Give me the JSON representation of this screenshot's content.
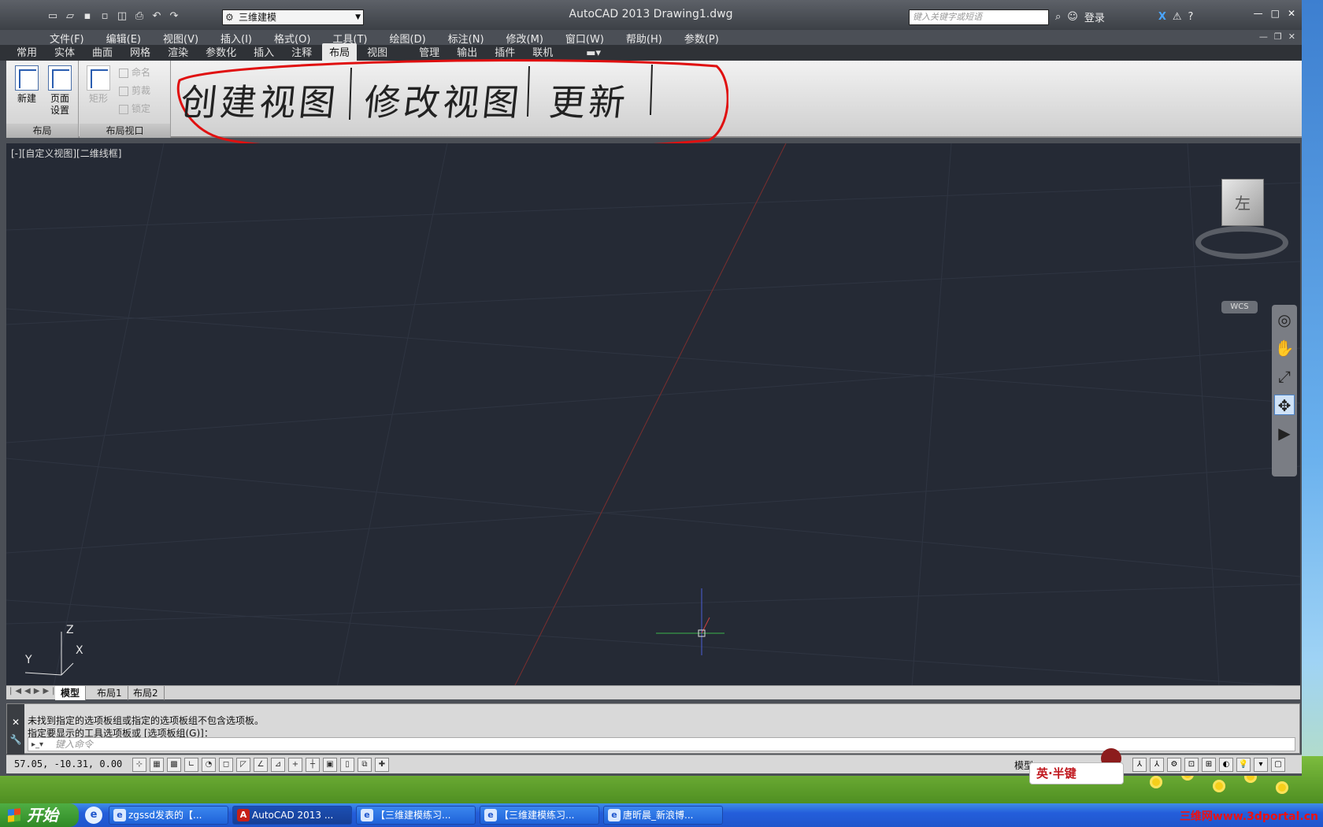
{
  "app": {
    "title": "AutoCAD 2013    Drawing1.dwg",
    "logo": "A",
    "workspace": "三维建模",
    "search_placeholder": "键入关键字或短语",
    "login_label": "登录"
  },
  "menu": [
    "文件(F)",
    "编辑(E)",
    "视图(V)",
    "插入(I)",
    "格式(O)",
    "工具(T)",
    "绘图(D)",
    "标注(N)",
    "修改(M)",
    "窗口(W)",
    "帮助(H)",
    "参数(P)"
  ],
  "ribbon_tabs": [
    {
      "label": "常用"
    },
    {
      "label": "实体"
    },
    {
      "label": "曲面"
    },
    {
      "label": "网格"
    },
    {
      "label": "渲染"
    },
    {
      "label": "参数化"
    },
    {
      "label": "插入"
    },
    {
      "label": "注释"
    },
    {
      "label": "布局",
      "active": true
    },
    {
      "label": "视图"
    },
    {
      "label": "管理"
    },
    {
      "label": "输出"
    },
    {
      "label": "插件"
    },
    {
      "label": "联机"
    }
  ],
  "ribbon": {
    "layout_panel": {
      "title": "布局",
      "new_label": "新建",
      "page_setup_label": "页面\n设置"
    },
    "viewport_panel": {
      "title": "布局视口",
      "rect_label": "矩形",
      "name_label": "命名",
      "clip_label": "剪裁",
      "lock_label": "锁定"
    },
    "annotation_handwriting": {
      "part1": "创建视图",
      "part2": "修改视图",
      "part3": "更新",
      "circle_color": "#e01010"
    }
  },
  "viewport": {
    "label": "[-][自定义视图][二维线框]",
    "viewcube_face": "左",
    "wcs_label": "WCS",
    "ucs_labels": {
      "z": "Z",
      "y": "Y",
      "x": "X"
    }
  },
  "layout_tabs": [
    "模型",
    "布局1",
    "布局2"
  ],
  "command": {
    "line1": "未找到指定的选项板组或指定的选项板组不包含选项板。",
    "line2": "指定要显示的工具选项板或 [选项板组(G)]：",
    "input_placeholder": "键入命令"
  },
  "status": {
    "coords": "57.05,  -10.31,  0.00",
    "model_label": "模型"
  },
  "ime": {
    "label": "英·半键"
  },
  "taskbar": {
    "start_label": "开始",
    "tasks": [
      {
        "label": "zgssd发表的【..."
      },
      {
        "label": "AutoCAD 2013 ...",
        "active": true
      },
      {
        "label": "【三维建模练习..."
      },
      {
        "label": "【三维建模练习..."
      },
      {
        "label": "唐昕晨_新浪博..."
      }
    ],
    "watermark": "三维网www.3dportal.cn"
  },
  "colors": {
    "viewport_bg": "#252a35",
    "ribbon_bg": "#e0e0e0",
    "taskbar": "#245edb",
    "start": "#3a9a30"
  }
}
